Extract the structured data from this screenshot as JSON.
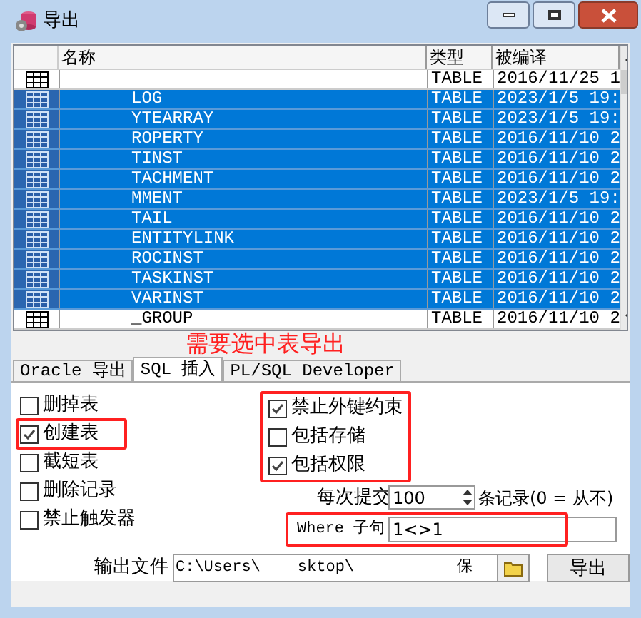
{
  "window": {
    "title": "导出"
  },
  "table": {
    "columns": [
      "名称",
      "类型",
      "被编译"
    ],
    "rows": [
      {
        "name": "",
        "type": "TABLE",
        "compiled": "2016/11/25 1",
        "selected": false
      },
      {
        "name": "LOG",
        "type": "TABLE",
        "compiled": "2023/1/5 19:",
        "selected": true
      },
      {
        "name": "YTEARRAY",
        "type": "TABLE",
        "compiled": "2023/1/5 19:",
        "selected": true
      },
      {
        "name": "ROPERTY",
        "type": "TABLE",
        "compiled": "2016/11/10 2",
        "selected": true
      },
      {
        "name": "TINST",
        "type": "TABLE",
        "compiled": "2016/11/10 2",
        "selected": true
      },
      {
        "name": "TACHMENT",
        "type": "TABLE",
        "compiled": "2016/11/10 2",
        "selected": true
      },
      {
        "name": "MMENT",
        "type": "TABLE",
        "compiled": "2023/1/5 19:",
        "selected": true
      },
      {
        "name": "TAIL",
        "type": "TABLE",
        "compiled": "2016/11/10 2",
        "selected": true
      },
      {
        "name": "ENTITYLINK",
        "type": "TABLE",
        "compiled": "2016/11/10 2",
        "selected": true
      },
      {
        "name": "ROCINST",
        "type": "TABLE",
        "compiled": "2016/11/10 2",
        "selected": true
      },
      {
        "name": "TASKINST",
        "type": "TABLE",
        "compiled": "2016/11/10 2",
        "selected": true
      },
      {
        "name": "VARINST",
        "type": "TABLE",
        "compiled": "2016/11/10 2",
        "selected": true
      },
      {
        "name": "_GROUP",
        "type": "TABLE",
        "compiled": "2016/11/10 2",
        "selected": false
      }
    ]
  },
  "annotation": "需要选中表导出",
  "tabs": [
    {
      "label": "Oracle 导出",
      "selected": false
    },
    {
      "label": "SQL 插入",
      "selected": true
    },
    {
      "label": "PL/SQL Developer",
      "selected": false
    }
  ],
  "options_left": [
    {
      "label": "删掉表",
      "checked": false,
      "highlighted": false
    },
    {
      "label": "创建表",
      "checked": true,
      "highlighted": true
    },
    {
      "label": "截短表",
      "checked": false,
      "highlighted": false
    },
    {
      "label": "删除记录",
      "checked": false,
      "highlighted": false
    },
    {
      "label": "禁止触发器",
      "checked": false,
      "highlighted": false
    }
  ],
  "options_right": {
    "highlighted": true,
    "items": [
      {
        "label": "禁止外键约束",
        "checked": true
      },
      {
        "label": "包括存储",
        "checked": false
      },
      {
        "label": "包括权限",
        "checked": true
      }
    ]
  },
  "commit": {
    "label": "每次提交",
    "value": "100",
    "suffix": "条记录(0 = 从不)"
  },
  "where": {
    "label": "Where 子句",
    "value": "1<>1",
    "highlighted": true
  },
  "output_file": {
    "label": "输出文件",
    "value_start": "C:\\Users\\",
    "value_middle": "sktop\\",
    "value_end": "保"
  },
  "export_button": "导出"
}
